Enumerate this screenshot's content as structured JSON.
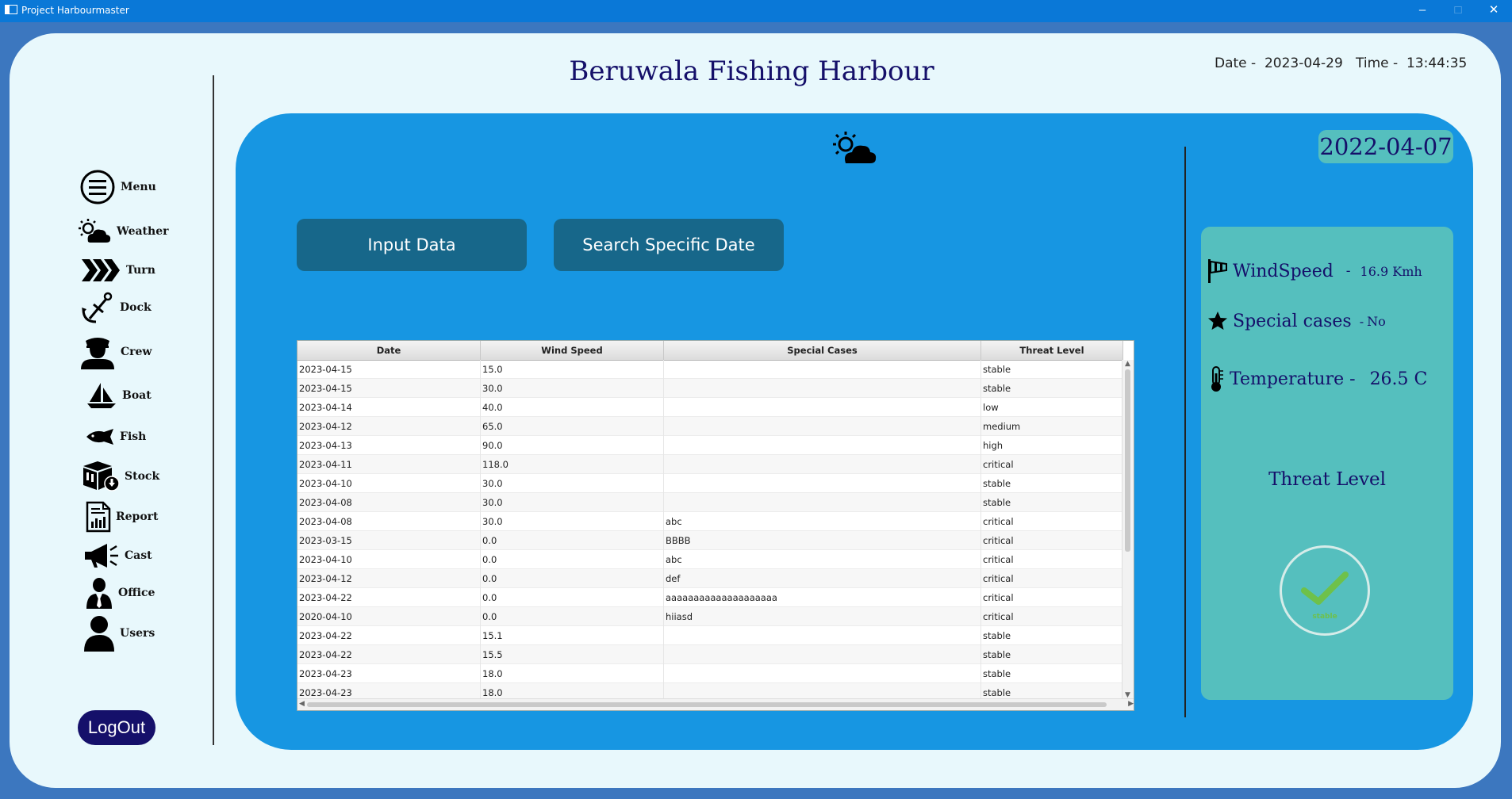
{
  "window": {
    "title": "Project Harbourmaster",
    "minimize": "–",
    "maximize": "□",
    "close": "✕"
  },
  "sidebar": {
    "items": [
      {
        "label": "Menu",
        "icon": "menu-icon"
      },
      {
        "label": "Weather",
        "icon": "weather-icon"
      },
      {
        "label": "Turn",
        "icon": "chevrons-icon"
      },
      {
        "label": "Dock",
        "icon": "anchor-icon"
      },
      {
        "label": "Crew",
        "icon": "captain-icon"
      },
      {
        "label": "Boat",
        "icon": "sailboat-icon"
      },
      {
        "label": "Fish",
        "icon": "fish-icon"
      },
      {
        "label": "Stock",
        "icon": "box-download-icon"
      },
      {
        "label": "Report",
        "icon": "report-chart-icon"
      },
      {
        "label": "Cast",
        "icon": "megaphone-icon"
      },
      {
        "label": "Office",
        "icon": "businessman-icon"
      },
      {
        "label": "Users",
        "icon": "user-icon"
      }
    ],
    "logout_label": "LogOut"
  },
  "header": {
    "title": "Beruwala Fishing Harbour",
    "date_label": "Date -",
    "date_value": "2023-04-29",
    "time_label": "Time -",
    "time_value": "13:44:35"
  },
  "main": {
    "weather_icon": "sun-cloud-icon",
    "input_button": "Input Data",
    "search_button": "Search Specific Date",
    "table": {
      "columns": [
        "Date",
        "Wind Speed",
        "Special Cases",
        "Threat Level"
      ],
      "rows": [
        [
          "2023-04-15",
          "15.0",
          "",
          "stable"
        ],
        [
          "2023-04-15",
          "30.0",
          "",
          "stable"
        ],
        [
          "2023-04-14",
          "40.0",
          "",
          "low"
        ],
        [
          "2023-04-12",
          "65.0",
          "",
          "medium"
        ],
        [
          "2023-04-13",
          "90.0",
          "",
          "high"
        ],
        [
          "2023-04-11",
          "118.0",
          "",
          "critical"
        ],
        [
          "2023-04-10",
          "30.0",
          "",
          "stable"
        ],
        [
          "2023-04-08",
          "30.0",
          "",
          "stable"
        ],
        [
          "2023-04-08",
          "30.0",
          "abc",
          "critical"
        ],
        [
          "2023-03-15",
          "0.0",
          "BBBB",
          "critical"
        ],
        [
          "2023-04-10",
          "0.0",
          "abc",
          "critical"
        ],
        [
          "2023-04-12",
          "0.0",
          "def",
          "critical"
        ],
        [
          "2023-04-22",
          "0.0",
          "aaaaaaaaaaaaaaaaaaaa",
          "critical"
        ],
        [
          "2020-04-10",
          "0.0",
          "hiiasd",
          "critical"
        ],
        [
          "2023-04-22",
          "15.1",
          "",
          "stable"
        ],
        [
          "2023-04-22",
          "15.5",
          "",
          "stable"
        ],
        [
          "2023-04-23",
          "18.0",
          "",
          "stable"
        ],
        [
          "2023-04-23",
          "18.0",
          "",
          "stable"
        ]
      ]
    }
  },
  "info": {
    "selected_date": "2022-04-07",
    "wind_label": "WindSpeed",
    "wind_sep": "-",
    "wind_value": "16.9 Kmh",
    "special_label": "Special cases",
    "special_sep": "-",
    "special_value": "No",
    "temp_label": "Temperature -",
    "temp_value": "26.5 C",
    "threat_title": "Threat Level",
    "threat_status": "stable",
    "colors": {
      "panel": "#1796e2",
      "info": "#55bfbe",
      "accent": "#15106a",
      "ok": "#6ec14a"
    }
  }
}
